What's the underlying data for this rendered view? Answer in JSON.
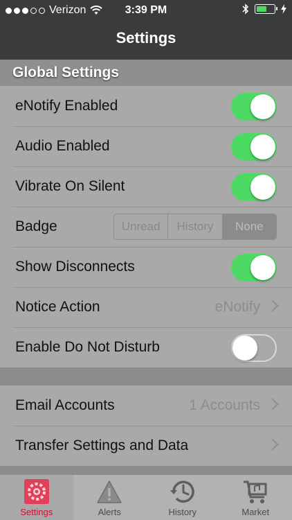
{
  "status_bar": {
    "carrier": "Verizon",
    "time": "3:39 PM",
    "signal_dots": [
      true,
      true,
      true,
      false,
      false
    ],
    "battery_level": 0.65,
    "battery_color": "#4cd964"
  },
  "nav": {
    "title": "Settings"
  },
  "global_settings": {
    "header": "Global Settings",
    "rows": [
      {
        "label": "eNotify Enabled",
        "type": "toggle",
        "on": true
      },
      {
        "label": "Audio Enabled",
        "type": "toggle",
        "on": true
      },
      {
        "label": "Vibrate On Silent",
        "type": "toggle",
        "on": true
      },
      {
        "label": "Badge",
        "type": "segmented",
        "options": [
          "Unread",
          "History",
          "None"
        ],
        "selected": "None"
      },
      {
        "label": "Show Disconnects",
        "type": "toggle",
        "on": true
      },
      {
        "label": "Notice Action",
        "type": "disclosure",
        "value": "eNotify"
      },
      {
        "label": "Enable Do Not Disturb",
        "type": "toggle",
        "on": false
      }
    ]
  },
  "accounts": {
    "rows": [
      {
        "label": "Email Accounts",
        "value": "1 Accounts"
      },
      {
        "label": "Transfer Settings and Data",
        "value": ""
      }
    ]
  },
  "tabbar": {
    "tabs": [
      {
        "label": "Settings",
        "icon": "gear-icon",
        "active": true
      },
      {
        "label": "Alerts",
        "icon": "warning-icon",
        "active": false
      },
      {
        "label": "History",
        "icon": "history-clock-icon",
        "active": false
      },
      {
        "label": "Market",
        "icon": "shopping-cart-icon",
        "active": false
      }
    ],
    "active_color": "#c8102e"
  }
}
